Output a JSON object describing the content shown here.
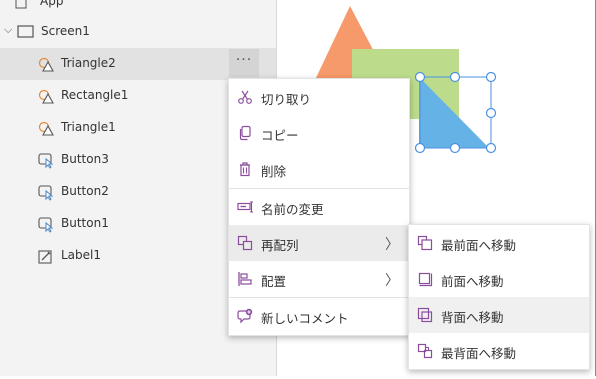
{
  "tree": {
    "app_label": "App",
    "screen_label": "Screen1",
    "items": [
      {
        "label": "Triangle2",
        "icon": "shape-icon",
        "selected": true
      },
      {
        "label": "Rectangle1",
        "icon": "shape-icon"
      },
      {
        "label": "Triangle1",
        "icon": "shape-icon"
      },
      {
        "label": "Button3",
        "icon": "button-icon"
      },
      {
        "label": "Button2",
        "icon": "button-icon"
      },
      {
        "label": "Button1",
        "icon": "button-icon"
      },
      {
        "label": "Label1",
        "icon": "label-icon"
      }
    ],
    "more_label": "···"
  },
  "context_menu": {
    "items": [
      {
        "label": "切り取り",
        "icon": "scissors-icon"
      },
      {
        "label": "コピー",
        "icon": "copy-icon"
      },
      {
        "label": "削除",
        "icon": "trash-icon"
      },
      {
        "label": "名前の変更",
        "icon": "rename-icon"
      },
      {
        "label": "再配列",
        "icon": "reorder-icon",
        "has_submenu": true,
        "highlighted": true
      },
      {
        "label": "配置",
        "icon": "align-icon",
        "has_submenu": true
      },
      {
        "label": "新しいコメント",
        "icon": "comment-icon"
      }
    ],
    "chevron": "〉"
  },
  "submenu": {
    "items": [
      {
        "label": "最前面へ移動",
        "icon": "bring-to-front-icon"
      },
      {
        "label": "前面へ移動",
        "icon": "bring-forward-icon"
      },
      {
        "label": "背面へ移動",
        "icon": "send-backward-icon",
        "highlighted": true
      },
      {
        "label": "最背面へ移動",
        "icon": "send-to-back-icon"
      }
    ]
  },
  "colors": {
    "orange_triangle": "#f79a6b",
    "green_rectangle": "#bcdc8c",
    "blue_triangle": "#64b2e6",
    "selection_handle": "#4a90e2",
    "icon_purple": "#8a4d9e",
    "tree_bg": "#f3f3f3"
  }
}
